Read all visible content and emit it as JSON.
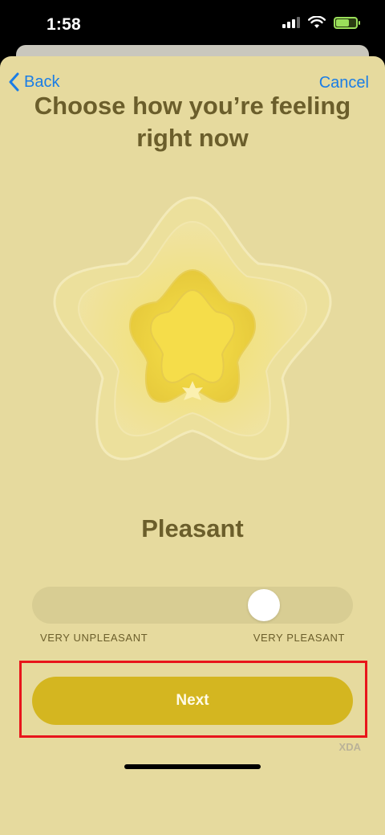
{
  "status_bar": {
    "time": "1:58",
    "icons": [
      "cellular-signal-icon",
      "wifi-icon",
      "battery-charging-icon"
    ]
  },
  "nav": {
    "back_label": "Back",
    "cancel_label": "Cancel"
  },
  "title": "Choose how you’re feeling right now",
  "mood": {
    "label": "Pleasant",
    "slider_position_fraction": 0.75,
    "min_label": "VERY UNPLEASANT",
    "max_label": "VERY PLEASANT"
  },
  "next_button": {
    "label": "Next"
  },
  "watermark": "XDA",
  "colors": {
    "background": "#e6da9e",
    "accent_blue": "#1a7de6",
    "text_brown": "#6b5e2b",
    "button_yellow": "#d4b620",
    "highlight_red": "#e8151b"
  }
}
